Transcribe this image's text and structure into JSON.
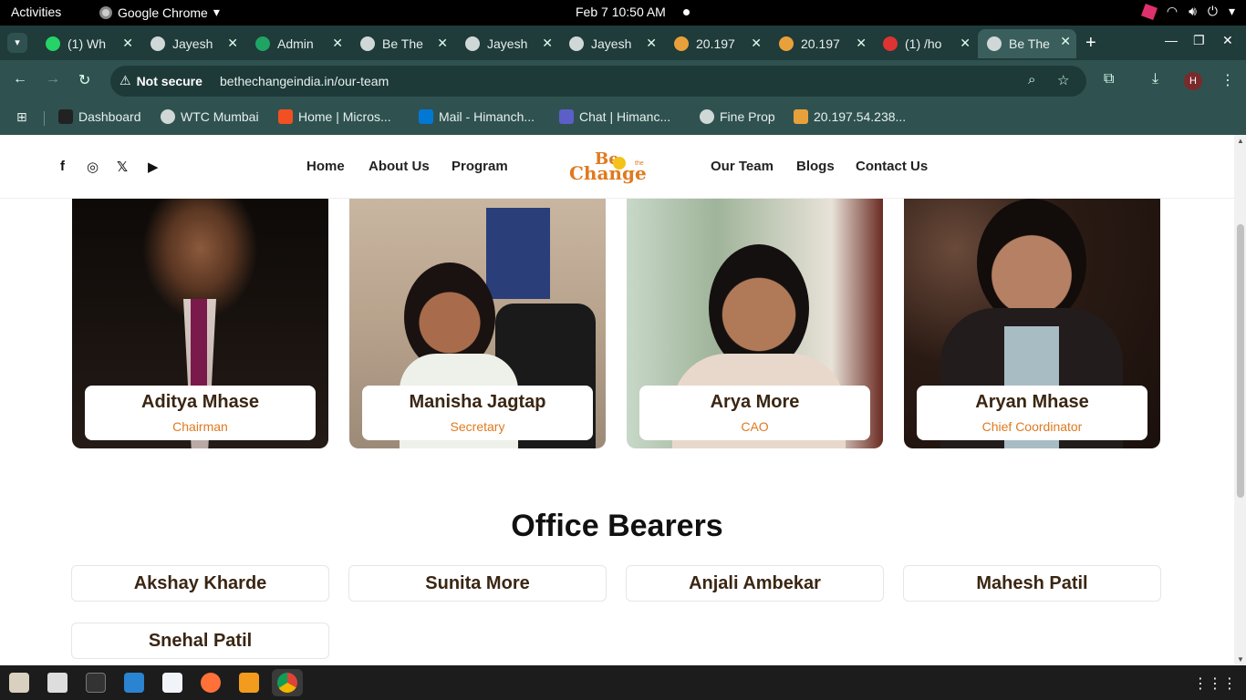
{
  "os": {
    "activities": "Activities",
    "app_name": "Google Chrome",
    "clock": "Feb 7  10:50 AM"
  },
  "tabs": [
    {
      "title": "(1) Wh",
      "icon": "whatsapp-icon",
      "color": "#25d366"
    },
    {
      "title": "Jayesh",
      "icon": "globe-icon",
      "color": "#cfd8d7"
    },
    {
      "title": "Admin",
      "icon": "sheets-icon",
      "color": "#1fa463"
    },
    {
      "title": "Be The",
      "icon": "globe-icon",
      "color": "#cfd8d7"
    },
    {
      "title": "Jayesh",
      "icon": "globe-icon",
      "color": "#cfd8d7"
    },
    {
      "title": "Jayesh",
      "icon": "globe-icon",
      "color": "#cfd8d7"
    },
    {
      "title": "20.197",
      "icon": "server-icon",
      "color": "#e8a13a"
    },
    {
      "title": "20.197",
      "icon": "server-icon",
      "color": "#e8a13a"
    },
    {
      "title": "(1) /ho",
      "icon": "notification-icon",
      "color": "#d33"
    },
    {
      "title": "Be The",
      "icon": "globe-icon",
      "color": "#cfd8d7",
      "active": true
    }
  ],
  "address": {
    "security": "Not secure",
    "url": "bethechangeindia.in/our-team"
  },
  "profile_initial": "H",
  "bookmarks": [
    {
      "label": "Dashboard",
      "icon": "dv-icon"
    },
    {
      "label": "WTC Mumbai",
      "icon": "globe-icon"
    },
    {
      "label": "Home | Micros...",
      "icon": "microsoft-icon"
    },
    {
      "label": "Mail - Himanch...",
      "icon": "outlook-icon"
    },
    {
      "label": "Chat | Himanc...",
      "icon": "teams-icon"
    },
    {
      "label": "Fine Prop",
      "icon": "globe-icon"
    },
    {
      "label": "20.197.54.238...",
      "icon": "server-icon"
    }
  ],
  "site": {
    "nav_left": [
      "Home",
      "About Us",
      "Program"
    ],
    "nav_right": [
      "Our Team",
      "Blogs",
      "Contact Us"
    ],
    "logo": {
      "be": "Be",
      "the": "the",
      "change": "Change"
    },
    "team": [
      {
        "name": "Aditya Mhase",
        "role": "Chairman"
      },
      {
        "name": "Manisha Jagtap",
        "role": "Secretary"
      },
      {
        "name": "Arya More",
        "role": "CAO"
      },
      {
        "name": "Aryan Mhase",
        "role": "Chief Coordinator"
      }
    ],
    "office_bearers_title": "Office Bearers",
    "office_bearers": [
      "Akshay Kharde",
      "Sunita More",
      "Anjali Ambekar",
      "Mahesh Patil",
      "Snehal Patil"
    ]
  },
  "colors": {
    "accent": "#e07a1f",
    "name_text": "#3a2613",
    "chrome_bg": "#2f5250"
  }
}
